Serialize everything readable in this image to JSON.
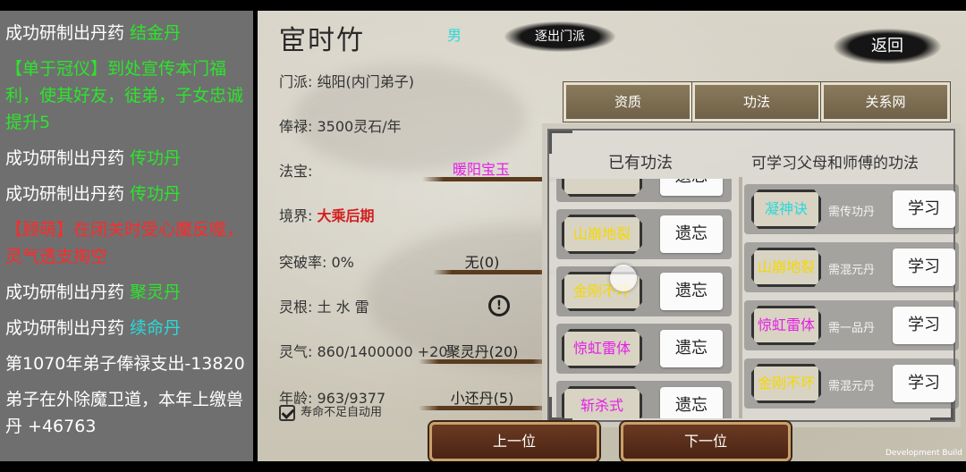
{
  "log": [
    {
      "text": "成功研制出丹药",
      "highlight": "结金丹",
      "color": "#2be52b"
    },
    {
      "text": "【单于冠仪】到处宣传本门福利，使其好友，徒弟，子女忠诚提升5",
      "highlight": "",
      "color": "#2be52b"
    },
    {
      "text": "成功研制出丹药",
      "highlight": "传功丹",
      "color": "#2be52b"
    },
    {
      "text": "成功研制出丹药",
      "highlight": "传功丹",
      "color": "#2be52b"
    },
    {
      "text": "【顾萌】在闭关时受心魔反噬，灵气透支掏空",
      "highlight": "",
      "color": "#ff2a2a"
    },
    {
      "text": "成功研制出丹药",
      "highlight": "聚灵丹",
      "color": "#2be52b"
    },
    {
      "text": "成功研制出丹药",
      "highlight": "续命丹",
      "color": "#2ad9d9"
    },
    {
      "text": "第1070年弟子俸禄支出-13820",
      "highlight": "",
      "color": ""
    },
    {
      "text": "弟子在外除魔卫道，本年上缴兽丹 +46763",
      "highlight": "",
      "color": ""
    }
  ],
  "character": {
    "name": "宦时竹",
    "gender": "男",
    "expel_label": "逐出门派",
    "back_label": "返回",
    "sect": "门派: 纯阳(内门弟子)",
    "salary": "俸禄: 3500灵石/年",
    "treasure_label": "法宝:",
    "treasure_value": "暖阳宝玉",
    "realm_label": "境界:",
    "realm_value": "大乘后期",
    "breakthrough": "突破率: 0%",
    "breakthrough_item": "无(0)",
    "root": "灵根: 土 水 雷",
    "alert_icon": "!",
    "qi": "灵气: 860/1400000 +20",
    "qi_item": "聚灵丹(20)",
    "age": "年龄: 963/9377",
    "age_item": "小还丹(5)",
    "auto_use": "寿命不足自动用"
  },
  "tabs": [
    "资质",
    "功法",
    "关系网"
  ],
  "gongfa": {
    "owned_title": "已有功法",
    "learnable_title": "可学习父母和师傅的功法",
    "owned": [
      {
        "name": "",
        "color": "#2ad9d9",
        "action": "遗忘"
      },
      {
        "name": "山崩地裂",
        "color": "#f5d800",
        "action": "遗忘"
      },
      {
        "name": "金刚不坏",
        "color": "#f5d800",
        "action": "遗忘"
      },
      {
        "name": "惊虹雷体",
        "color": "#e51ee5",
        "action": "遗忘"
      },
      {
        "name": "斩杀式",
        "color": "#e51ee5",
        "action": "遗忘"
      }
    ],
    "learnable": [
      {
        "name": "凝神诀",
        "color": "#2ad9d9",
        "req": "需传功丹",
        "action": "学习"
      },
      {
        "name": "山崩地裂",
        "color": "#f5d800",
        "req": "需混元丹",
        "action": "学习"
      },
      {
        "name": "惊虹雷体",
        "color": "#e51ee5",
        "req": "需一品丹",
        "action": "学习"
      },
      {
        "name": "金刚不坏",
        "color": "#f5d800",
        "req": "需混元丹",
        "action": "学习"
      }
    ]
  },
  "nav": {
    "prev": "上一位",
    "next": "下一位"
  },
  "dev_build": "Development Build"
}
